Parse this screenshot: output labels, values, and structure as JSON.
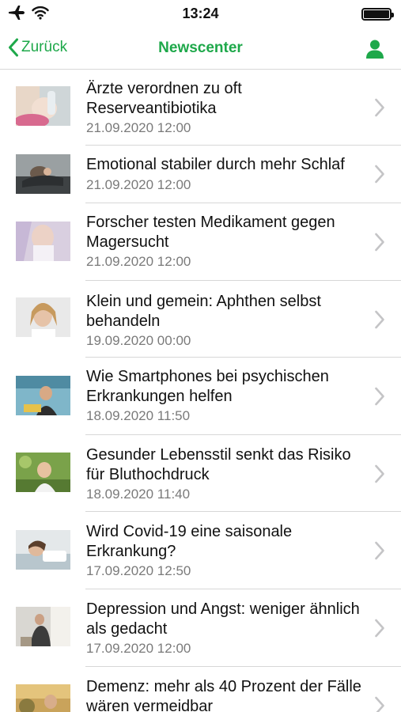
{
  "status_bar": {
    "time": "13:24",
    "icons": [
      "airplane-icon",
      "wifi-icon",
      "battery-icon"
    ]
  },
  "nav": {
    "back_label": "Zurück",
    "title": "Newscenter",
    "right_icon": "person-icon"
  },
  "colors": {
    "accent": "#1ea84a",
    "date_text": "#7a7a7a",
    "separator": "#d7d7d7",
    "chevron": "#c4c4c6"
  },
  "news": [
    {
      "title": "Ärzte verordnen zu oft Reserveantibiotika",
      "date": "21.09.2020 12:00"
    },
    {
      "title": "Emotional stabiler durch mehr Schlaf",
      "date": "21.09.2020 12:00"
    },
    {
      "title": "Forscher testen Medikament gegen Magersucht",
      "date": "21.09.2020 12:00"
    },
    {
      "title": "Klein und gemein: Aphthen selbst behandeln",
      "date": "19.09.2020 00:00"
    },
    {
      "title": "Wie Smartphones bei psychischen Erkrankungen helfen",
      "date": "18.09.2020 11:50"
    },
    {
      "title": "Gesunder Lebensstil senkt das Risiko für Bluthochdruck",
      "date": "18.09.2020 11:40"
    },
    {
      "title": "Wird Covid-19 eine saisonale Erkrankung?",
      "date": "17.09.2020 12:50"
    },
    {
      "title": "Depression und Angst: weniger ähnlich als gedacht",
      "date": "17.09.2020 12:00"
    },
    {
      "title": "Demenz: mehr als 40 Prozent der Fälle wären vermeidbar",
      "date": ""
    }
  ]
}
